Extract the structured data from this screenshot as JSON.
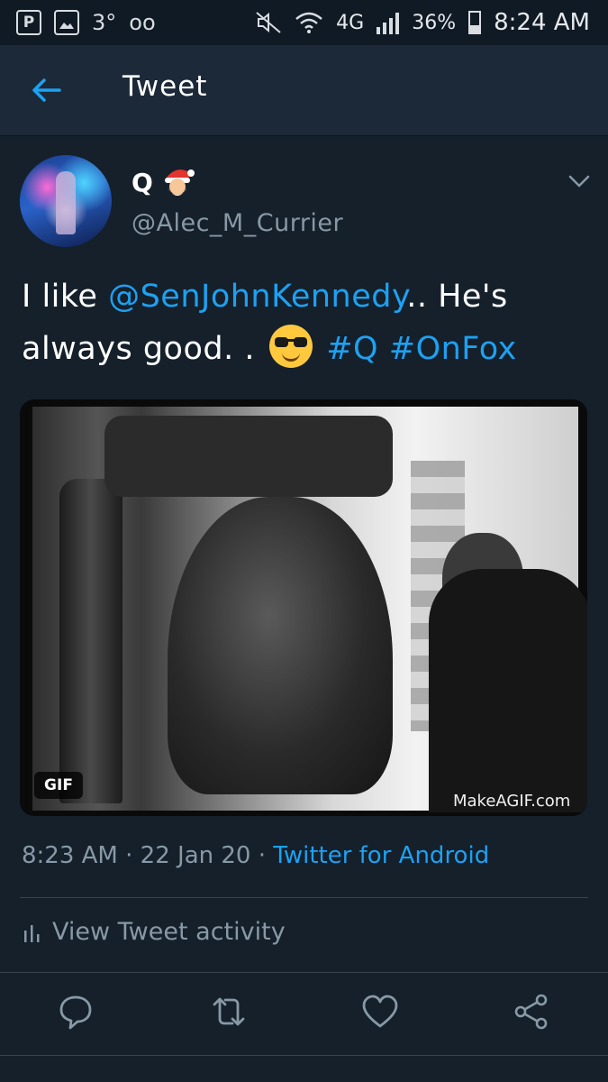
{
  "status_bar": {
    "left_icon_1": "P",
    "temperature": "3°",
    "voicemail": "oo",
    "network": "4G",
    "battery": "36%",
    "battery_level": 0.36,
    "time": "8:24 AM"
  },
  "header": {
    "title": "Tweet"
  },
  "tweet": {
    "display_name": "Q",
    "handle": "@Alec_M_Currier",
    "text_part1": "I like ",
    "mention": "@SenJohnKennedy",
    "text_part2": ".. He's always good. . ",
    "hashtag1": "#Q",
    "hashtag2": "#OnFox",
    "media_badge": "GIF",
    "media_watermark": "MakeAGIF.com",
    "time": "8:23 AM",
    "date": "22 Jan 20",
    "source": "Twitter for Android",
    "activity_label": "View Tweet activity"
  },
  "colors": {
    "background": "#15202b",
    "header": "#1c2938",
    "accent": "#1da1f2",
    "secondary_text": "#8899a6",
    "divider": "#38444d"
  },
  "icons": {
    "back": "arrow-left-icon",
    "caret": "chevron-down-icon",
    "reply": "reply-icon",
    "retweet": "retweet-icon",
    "like": "heart-icon",
    "share": "share-icon",
    "activity": "bar-chart-icon"
  }
}
